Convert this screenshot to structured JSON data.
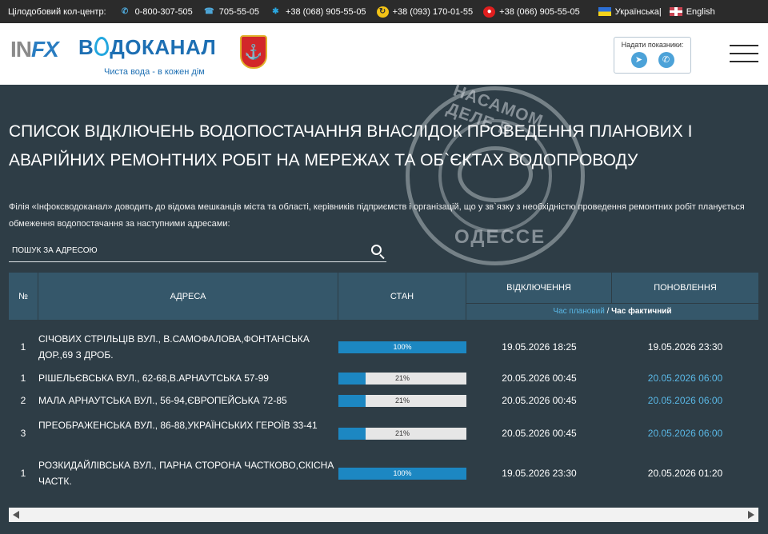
{
  "topbar": {
    "callcenter_label": "Цілодобовий кол-центр:",
    "phones": [
      {
        "icon": "phone-icon",
        "number": "0-800-307-505"
      },
      {
        "icon": "fax-icon",
        "number": "705-55-05"
      },
      {
        "icon": "kyivstar-icon",
        "number": "+38 (068) 905-55-05"
      },
      {
        "icon": "lifecell-icon",
        "number": "+38 (093) 170-01-55"
      },
      {
        "icon": "vodafone-icon",
        "number": "+38 (066) 905-55-05"
      }
    ],
    "lang_ua": "Українська",
    "lang_sep": "|",
    "lang_en": "English"
  },
  "header": {
    "logo_inf": "INF",
    "logo_name_a": "В",
    "logo_name_b": "ДОКАНАЛ",
    "logo_slogan": "Чиста вода - в кожен дім",
    "coat_symbol": "⚓",
    "meter_title": "Надати показники:",
    "meter_icons": [
      "telegram-icon",
      "viber-icon"
    ]
  },
  "watermark": {
    "top_text": "НАСАМОМ ДЕЛЕ В",
    "bottom_text": "ОДЕССЕ"
  },
  "page": {
    "title": "Список відключень водопостачання внаслідок проведення планових і аварійних ремонтних робіт на мережах та об`єктах водопроводу",
    "intro": "Філія «Інфоксводоканал» доводить до відома мешканців міста та області, керівників підприємств і організацій, що у зв`язку з необхідністю проведення ремонтних робіт планується обмеження водопостачання за наступними адресами:",
    "search_placeholder": "Пошук за адресою"
  },
  "table": {
    "headers": {
      "num": "№",
      "address": "Адреса",
      "state": "Стан",
      "off": "Відключення",
      "update": "Поновлення"
    },
    "sub_planned": "Час плановий",
    "sub_sep": " / ",
    "sub_actual": "Час фактичний",
    "rows": [
      {
        "num": "1",
        "address": "СІЧОВИХ СТРІЛЬЦІВ ВУЛ., В.САМОФАЛОВА,ФОНТАНСЬКА ДОР.,69 З ДРОБ.",
        "progress": 100,
        "progress_label": "100%",
        "off": "19.05.2026 18:25",
        "update": "19.05.2026 23:30",
        "update_planned": false
      },
      {
        "num": "1",
        "address": "РІШЕЛЬЄВСЬКА ВУЛ., 62-68,В.АРНАУТСЬКА 57-99",
        "progress": 21,
        "progress_label": "21%",
        "off": "20.05.2026 00:45",
        "update": "20.05.2026 06:00",
        "update_planned": true
      },
      {
        "num": "2",
        "address": "МАЛА АРНАУТСЬКА ВУЛ., 56-94,ЄВРОПЕЙСЬКА 72-85",
        "progress": 21,
        "progress_label": "21%",
        "off": "20.05.2026 00:45",
        "update": "20.05.2026 06:00",
        "update_planned": true
      },
      {
        "num": "3",
        "address": "ПРЕОБРАЖЕНСЬКА ВУЛ., 86-88,УКРАЇНСЬКИХ ГЕРОЇВ 33-41",
        "progress": 21,
        "progress_label": "21%",
        "off": "20.05.2026 00:45",
        "update": "20.05.2026 06:00",
        "update_planned": true
      },
      {
        "num": "1",
        "address": "РОЗКИДАЙЛІВСЬКА ВУЛ., ПАРНА СТОРОНА ЧАСТКОВО,СКІСНА ЧАСТК.",
        "progress": 100,
        "progress_label": "100%",
        "off": "19.05.2026 23:30",
        "update": "20.05.2026 01:20",
        "update_planned": false
      }
    ]
  }
}
